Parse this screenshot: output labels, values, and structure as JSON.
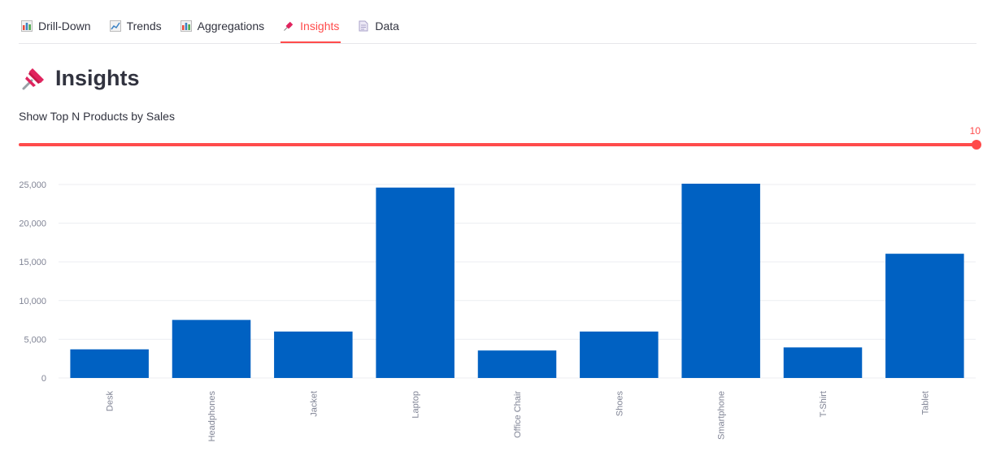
{
  "tabs": [
    {
      "label": "Drill-Down",
      "icon": "bar-chart-icon",
      "active": false
    },
    {
      "label": "Trends",
      "icon": "line-chart-icon",
      "active": false
    },
    {
      "label": "Aggregations",
      "icon": "bar-chart-icon",
      "active": false
    },
    {
      "label": "Insights",
      "icon": "pushpin-icon",
      "active": true
    },
    {
      "label": "Data",
      "icon": "document-icon",
      "active": false
    }
  ],
  "page": {
    "title": "Insights",
    "title_icon": "pushpin-icon"
  },
  "slider": {
    "label": "Show Top N Products by Sales",
    "value": "10",
    "fill_fraction": 1.0
  },
  "colors": {
    "accent": "#ff4b4b",
    "bar": "#0061c2"
  },
  "chart_data": {
    "type": "bar",
    "categories": [
      "Desk",
      "Headphones",
      "Jacket",
      "Laptop",
      "Office Chair",
      "Shoes",
      "Smartphone",
      "T-Shirt",
      "Tablet"
    ],
    "values": [
      3700,
      7500,
      6000,
      24600,
      3550,
      6000,
      25100,
      3950,
      16050
    ],
    "yticks": [
      0,
      5000,
      10000,
      15000,
      20000,
      25000
    ],
    "ytick_labels": [
      "0",
      "5,000",
      "10,000",
      "15,000",
      "20,000",
      "25,000"
    ],
    "ylim": [
      0,
      25100
    ],
    "grid": true,
    "title": "",
    "xlabel": "",
    "ylabel": ""
  }
}
